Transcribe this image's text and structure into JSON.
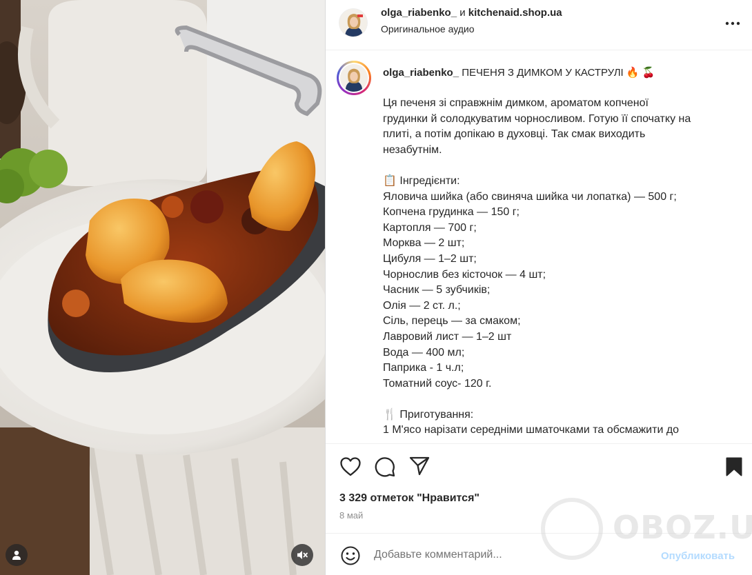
{
  "header": {
    "username": "olga_riabenko_",
    "connector": " и ",
    "collaborator": "kitchenaid.shop.ua",
    "audio": "Оригинальное аудио",
    "more_icon": "more-horizontal-icon"
  },
  "caption": {
    "username": "olga_riabenko_",
    "title": "ПЕЧЕНЯ З ДИМКОМ У КАСТРУЛІ 🔥 🍒",
    "lines": [
      "Ця печеня зі справжнім димком, ароматом копченої",
      "грудинки й солодкуватим чорносливом. Готую її спочатку на",
      "плиті, а потім допікаю в духовці. Так смак виходить",
      "незабутнім.",
      "",
      "📋 Інгредієнти:",
      "Яловича шийка (або свиняча шийка чи лопатка) — 500 г;",
      "Копчена грудинка — 150 г;",
      "Картопля — 700 г;",
      "Морква — 2 шт;",
      "Цибуля — 1–2 шт;",
      "Чорнослив без кісточок — 4 шт;",
      "Часник — 5 зубчиків;",
      "Олія — 2 ст. л.;",
      "Сіль, перець — за смаком;",
      "Лавровий лист — 1–2 шт",
      "Вода — 400 мл;",
      "Паприка - 1 ч.л;",
      "Томатний соус- 120 г.",
      "",
      "🍴 Приготування:",
      "1 М'ясо нарізати середніми шматочками та обсмажити до"
    ]
  },
  "actions": {
    "likes": "3 329 отметок \"Нравится\"",
    "date": "8 май"
  },
  "comment": {
    "placeholder": "Добавьте комментарий...",
    "publish": "Опубликовать"
  },
  "watermark": {
    "text": "OBOZ.UA"
  },
  "colors": {
    "publish": "#b3dbff",
    "secondary_text": "#8e8e8e",
    "border": "#dbdbdb"
  }
}
